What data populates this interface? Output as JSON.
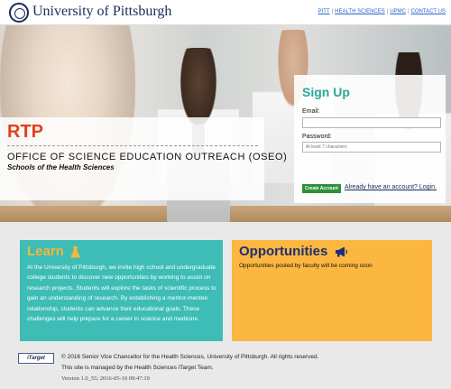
{
  "header": {
    "brand": "University of Pittsburgh",
    "links": [
      "PITT",
      "HEALTH SCIENCES",
      "UPMC",
      "CONTACT US"
    ]
  },
  "hero": {
    "program": "RTP",
    "office_title": "OFFICE OF SCIENCE EDUCATION OUTREACH (OSEO)",
    "school": "Schools of the Health Sciences"
  },
  "signup": {
    "title": "Sign Up",
    "email_label": "Email:",
    "email_value": "",
    "password_label": "Password:",
    "password_placeholder": "At least 7 characters",
    "create_button": "Create Account",
    "login_link": "Already have an account? Login."
  },
  "learn": {
    "title": "Learn",
    "icon": "flask-icon",
    "text": "At the University of Pittsburgh, we invite high school and undergraduate college students to discover new opportunities by working to assist on research projects. Students will explore the tasks of scientific process to gain an understanding of research. By establishing a mentor-mentee relationship, students can advance their educational goals. These challenges will help prepare for a career in science and medicine."
  },
  "opportunities": {
    "title": "Opportunities",
    "icon": "megaphone-icon",
    "text": "Opportunities posted by faculty will be coming soon"
  },
  "footer": {
    "logo_text": "iTarget",
    "copyright": "© 2016 Senior Vice Chancellor for the Health Sciences, University of Pittsburgh. All rights reserved.",
    "managed": "This site is managed by the Health Sciences iTarget Team.",
    "version": "Version 1.0_55; 2016-05-10 09:47:19"
  },
  "colors": {
    "brand_navy": "#1c2a57",
    "rtp_red": "#e0401a",
    "teal": "#3dbdb6",
    "orange": "#fbb740",
    "button_green": "#2f8f3d"
  }
}
